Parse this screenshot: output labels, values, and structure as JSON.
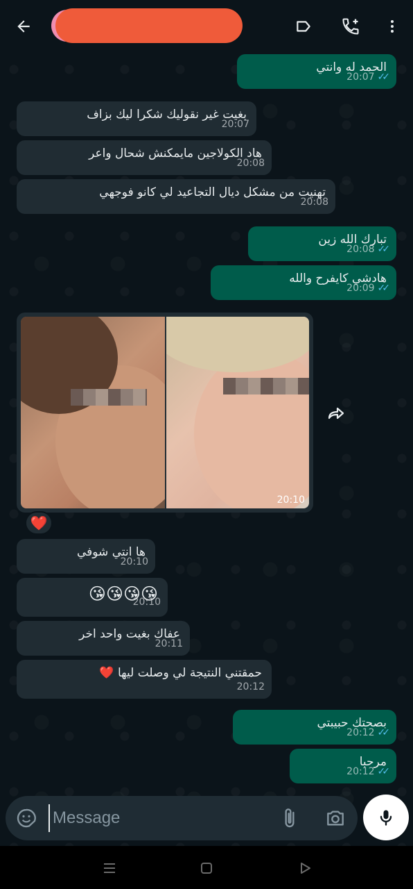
{
  "header": {
    "contact_name": "",
    "back_icon": "arrow-left-icon",
    "label_icon": "label-icon",
    "call_icon": "add-call-icon",
    "menu_icon": "more-vert-icon"
  },
  "messages": [
    {
      "dir": "out",
      "text": "الحمد له وانتي",
      "time": "20:07"
    },
    {
      "dir": "in",
      "text": "بغيت غير نقوليك شكرا ليك بزاف",
      "time": "20:07"
    },
    {
      "dir": "in",
      "text": "هاد الكولاجين مايمكنش شحال واعر",
      "time": "20:08"
    },
    {
      "dir": "in",
      "text": "تهنيت من مشكل ديال التجاعيد لي كانو فوجهي",
      "time": "20:08"
    },
    {
      "dir": "out",
      "text": "تبارك الله زين",
      "time": "20:08"
    },
    {
      "dir": "out",
      "text": "هادشي كايفرح والله",
      "time": "20:09"
    },
    {
      "dir": "in",
      "text": "ها انتي شوفي",
      "time": "20:10"
    },
    {
      "dir": "in",
      "text": "😘😘😘😘",
      "time": "20:10"
    },
    {
      "dir": "in",
      "text": "عفاك بغيت واحد اخر",
      "time": "20:11"
    },
    {
      "dir": "in",
      "text": "حمقتني النتيجة لي وصلت ليها ❤️",
      "time": "20:12"
    },
    {
      "dir": "out",
      "text": "بصحتك حبيبتي",
      "time": "20:12"
    },
    {
      "dir": "out",
      "text": "مرحبا",
      "time": "20:12"
    }
  ],
  "image_message": {
    "time": "20:10",
    "reaction": "❤️"
  },
  "input": {
    "placeholder": "Message"
  },
  "colors": {
    "incoming": "#202c33",
    "outgoing": "#005c4b",
    "ticks": "#53bdeb",
    "background": "#0b141a"
  }
}
